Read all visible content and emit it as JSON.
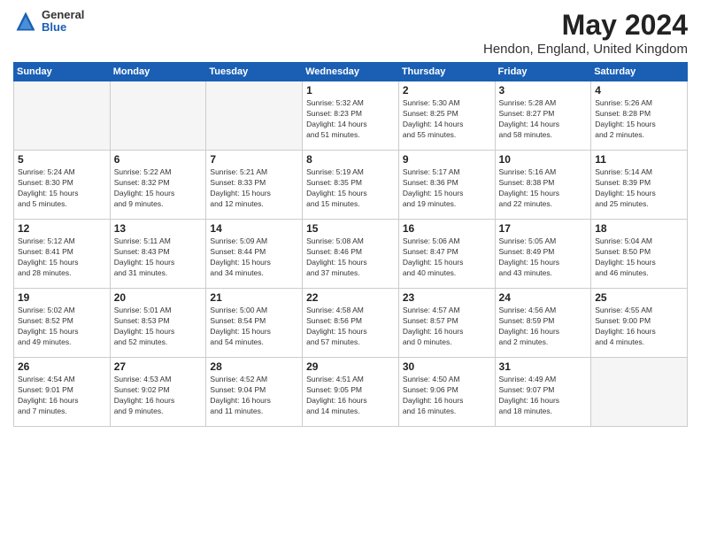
{
  "logo": {
    "general": "General",
    "blue": "Blue"
  },
  "title": "May 2024",
  "location": "Hendon, England, United Kingdom",
  "days_of_week": [
    "Sunday",
    "Monday",
    "Tuesday",
    "Wednesday",
    "Thursday",
    "Friday",
    "Saturday"
  ],
  "weeks": [
    [
      {
        "day": "",
        "info": ""
      },
      {
        "day": "",
        "info": ""
      },
      {
        "day": "",
        "info": ""
      },
      {
        "day": "1",
        "info": "Sunrise: 5:32 AM\nSunset: 8:23 PM\nDaylight: 14 hours\nand 51 minutes."
      },
      {
        "day": "2",
        "info": "Sunrise: 5:30 AM\nSunset: 8:25 PM\nDaylight: 14 hours\nand 55 minutes."
      },
      {
        "day": "3",
        "info": "Sunrise: 5:28 AM\nSunset: 8:27 PM\nDaylight: 14 hours\nand 58 minutes."
      },
      {
        "day": "4",
        "info": "Sunrise: 5:26 AM\nSunset: 8:28 PM\nDaylight: 15 hours\nand 2 minutes."
      }
    ],
    [
      {
        "day": "5",
        "info": "Sunrise: 5:24 AM\nSunset: 8:30 PM\nDaylight: 15 hours\nand 5 minutes."
      },
      {
        "day": "6",
        "info": "Sunrise: 5:22 AM\nSunset: 8:32 PM\nDaylight: 15 hours\nand 9 minutes."
      },
      {
        "day": "7",
        "info": "Sunrise: 5:21 AM\nSunset: 8:33 PM\nDaylight: 15 hours\nand 12 minutes."
      },
      {
        "day": "8",
        "info": "Sunrise: 5:19 AM\nSunset: 8:35 PM\nDaylight: 15 hours\nand 15 minutes."
      },
      {
        "day": "9",
        "info": "Sunrise: 5:17 AM\nSunset: 8:36 PM\nDaylight: 15 hours\nand 19 minutes."
      },
      {
        "day": "10",
        "info": "Sunrise: 5:16 AM\nSunset: 8:38 PM\nDaylight: 15 hours\nand 22 minutes."
      },
      {
        "day": "11",
        "info": "Sunrise: 5:14 AM\nSunset: 8:39 PM\nDaylight: 15 hours\nand 25 minutes."
      }
    ],
    [
      {
        "day": "12",
        "info": "Sunrise: 5:12 AM\nSunset: 8:41 PM\nDaylight: 15 hours\nand 28 minutes."
      },
      {
        "day": "13",
        "info": "Sunrise: 5:11 AM\nSunset: 8:43 PM\nDaylight: 15 hours\nand 31 minutes."
      },
      {
        "day": "14",
        "info": "Sunrise: 5:09 AM\nSunset: 8:44 PM\nDaylight: 15 hours\nand 34 minutes."
      },
      {
        "day": "15",
        "info": "Sunrise: 5:08 AM\nSunset: 8:46 PM\nDaylight: 15 hours\nand 37 minutes."
      },
      {
        "day": "16",
        "info": "Sunrise: 5:06 AM\nSunset: 8:47 PM\nDaylight: 15 hours\nand 40 minutes."
      },
      {
        "day": "17",
        "info": "Sunrise: 5:05 AM\nSunset: 8:49 PM\nDaylight: 15 hours\nand 43 minutes."
      },
      {
        "day": "18",
        "info": "Sunrise: 5:04 AM\nSunset: 8:50 PM\nDaylight: 15 hours\nand 46 minutes."
      }
    ],
    [
      {
        "day": "19",
        "info": "Sunrise: 5:02 AM\nSunset: 8:52 PM\nDaylight: 15 hours\nand 49 minutes."
      },
      {
        "day": "20",
        "info": "Sunrise: 5:01 AM\nSunset: 8:53 PM\nDaylight: 15 hours\nand 52 minutes."
      },
      {
        "day": "21",
        "info": "Sunrise: 5:00 AM\nSunset: 8:54 PM\nDaylight: 15 hours\nand 54 minutes."
      },
      {
        "day": "22",
        "info": "Sunrise: 4:58 AM\nSunset: 8:56 PM\nDaylight: 15 hours\nand 57 minutes."
      },
      {
        "day": "23",
        "info": "Sunrise: 4:57 AM\nSunset: 8:57 PM\nDaylight: 16 hours\nand 0 minutes."
      },
      {
        "day": "24",
        "info": "Sunrise: 4:56 AM\nSunset: 8:59 PM\nDaylight: 16 hours\nand 2 minutes."
      },
      {
        "day": "25",
        "info": "Sunrise: 4:55 AM\nSunset: 9:00 PM\nDaylight: 16 hours\nand 4 minutes."
      }
    ],
    [
      {
        "day": "26",
        "info": "Sunrise: 4:54 AM\nSunset: 9:01 PM\nDaylight: 16 hours\nand 7 minutes."
      },
      {
        "day": "27",
        "info": "Sunrise: 4:53 AM\nSunset: 9:02 PM\nDaylight: 16 hours\nand 9 minutes."
      },
      {
        "day": "28",
        "info": "Sunrise: 4:52 AM\nSunset: 9:04 PM\nDaylight: 16 hours\nand 11 minutes."
      },
      {
        "day": "29",
        "info": "Sunrise: 4:51 AM\nSunset: 9:05 PM\nDaylight: 16 hours\nand 14 minutes."
      },
      {
        "day": "30",
        "info": "Sunrise: 4:50 AM\nSunset: 9:06 PM\nDaylight: 16 hours\nand 16 minutes."
      },
      {
        "day": "31",
        "info": "Sunrise: 4:49 AM\nSunset: 9:07 PM\nDaylight: 16 hours\nand 18 minutes."
      },
      {
        "day": "",
        "info": ""
      }
    ]
  ]
}
